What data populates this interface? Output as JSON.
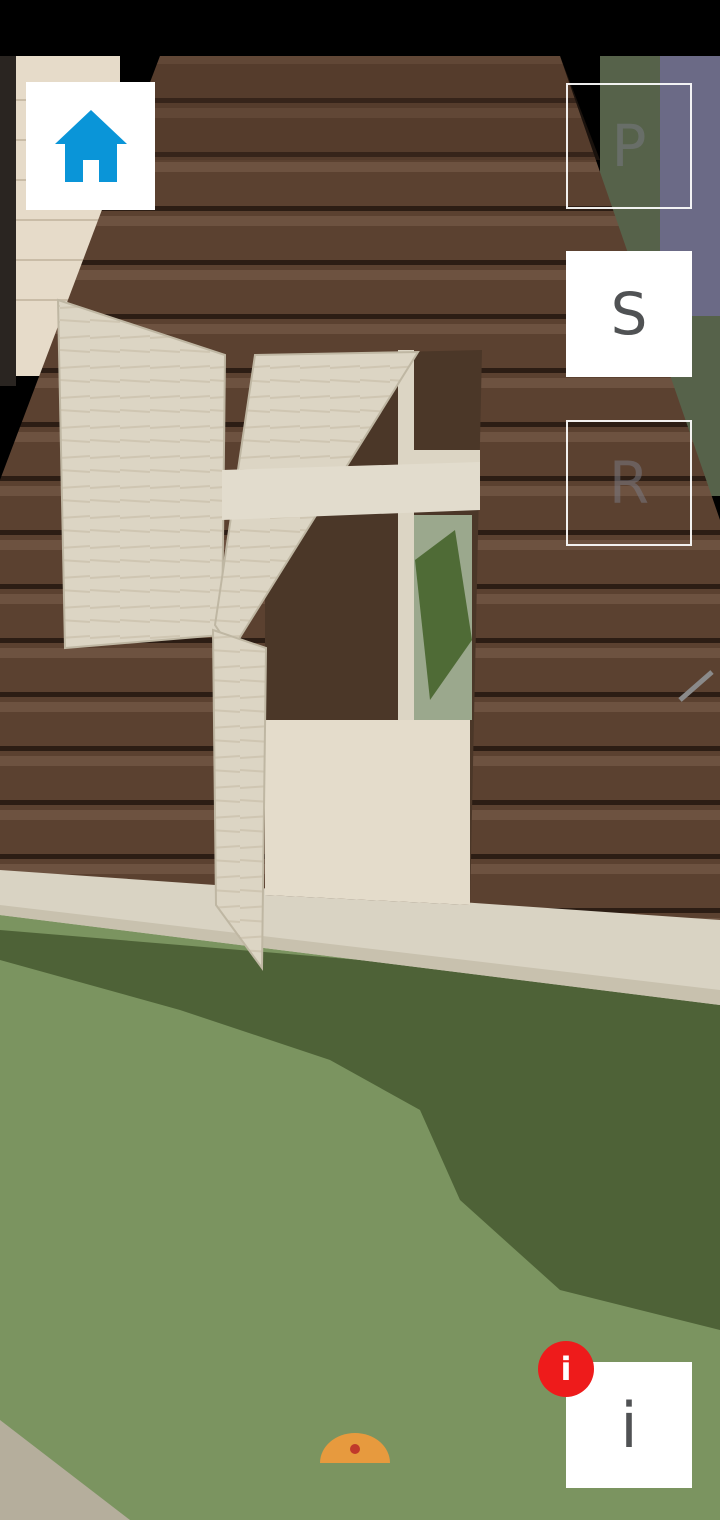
{
  "hud": {
    "home_icon": "home-icon",
    "home_color": "#0a95d8",
    "buttons": {
      "p_label": "P",
      "s_label": "S",
      "r_label": "R",
      "info_label": "i"
    },
    "notification_badge": "i",
    "badge_color": "#ee1b1b"
  }
}
